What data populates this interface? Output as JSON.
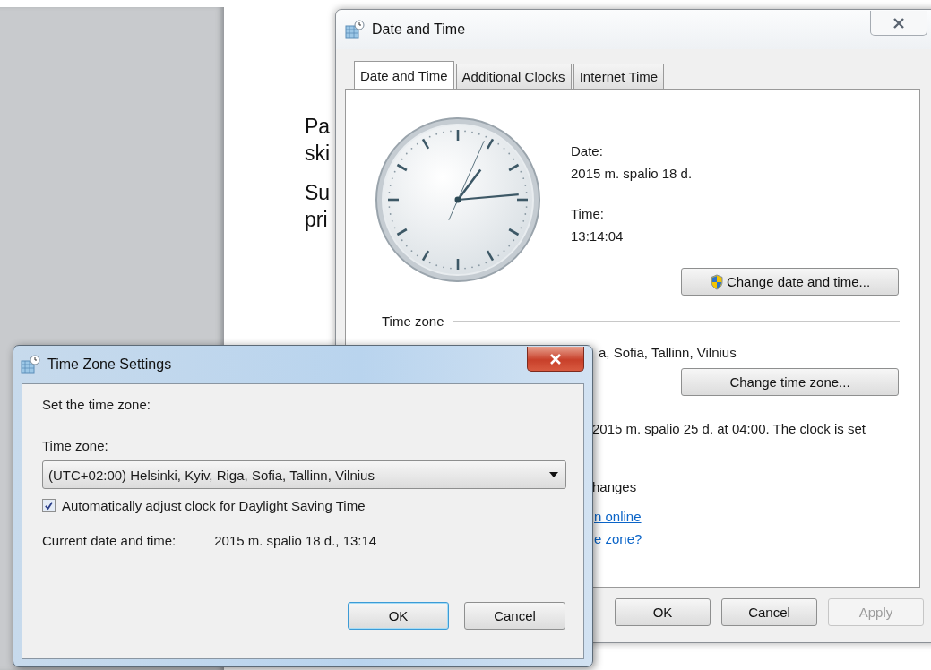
{
  "background_document": {
    "paragraphs": [
      [
        "Pa",
        "ski"
      ],
      [
        "Su",
        "pri"
      ]
    ]
  },
  "date_time_window": {
    "title": "Date and Time",
    "tabs": [
      {
        "label": "Date and Time",
        "selected": true
      },
      {
        "label": "Additional Clocks",
        "selected": false
      },
      {
        "label": "Internet Time",
        "selected": false
      }
    ],
    "date_label": "Date:",
    "date": "2015 m. spalio 18 d.",
    "time_label": "Time:",
    "time": "13:14:04",
    "change_date_button": "Change date and time...",
    "time_zone_heading": "Time zone",
    "time_zone_value": "a, Sofia, Tallinn, Vilnius",
    "change_time_zone_button": "Change time zone...",
    "dst_text": "2015 m. spalio 25 d. at 04:00. The clock is set",
    "dst_text_2": "hanges",
    "links": [
      "n online",
      "e zone?"
    ],
    "buttons": [
      {
        "label": "OK",
        "disabled": false
      },
      {
        "label": "Cancel",
        "disabled": false
      },
      {
        "label": "Apply",
        "disabled": true
      }
    ]
  },
  "time_zone_window": {
    "title": "Time Zone Settings",
    "prompt": "Set the time zone:",
    "time_zone_label": "Time zone:",
    "time_zone_select": "(UTC+02:00) Helsinki, Kyiv, Riga, Sofia, Tallinn, Vilnius",
    "dst_checkbox": {
      "label": "Automatically adjust clock for Daylight Saving Time",
      "checked": true
    },
    "current_label": "Current date and time:",
    "current_value": "2015 m. spalio 18 d., 13:14",
    "buttons": [
      {
        "label": "OK",
        "default": true
      },
      {
        "label": "Cancel",
        "default": false
      }
    ]
  }
}
